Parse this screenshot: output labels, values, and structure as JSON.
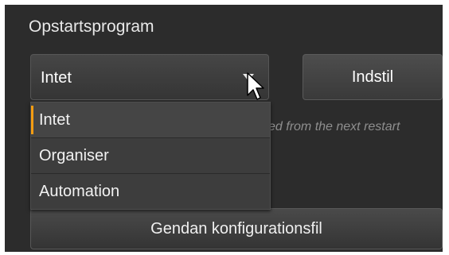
{
  "panel": {
    "title": "Opstartsprogram"
  },
  "startup_select": {
    "value": "Intet",
    "options": [
      "Intet",
      "Organiser",
      "Automation"
    ],
    "selected_index": 0
  },
  "set_button": {
    "label": "Indstil"
  },
  "hint_text": "ed from the next restart",
  "restore_button": {
    "label": "Gendan konfigurationsfil"
  },
  "colors": {
    "accent": "#f39c12",
    "background": "#2c2c2c"
  }
}
